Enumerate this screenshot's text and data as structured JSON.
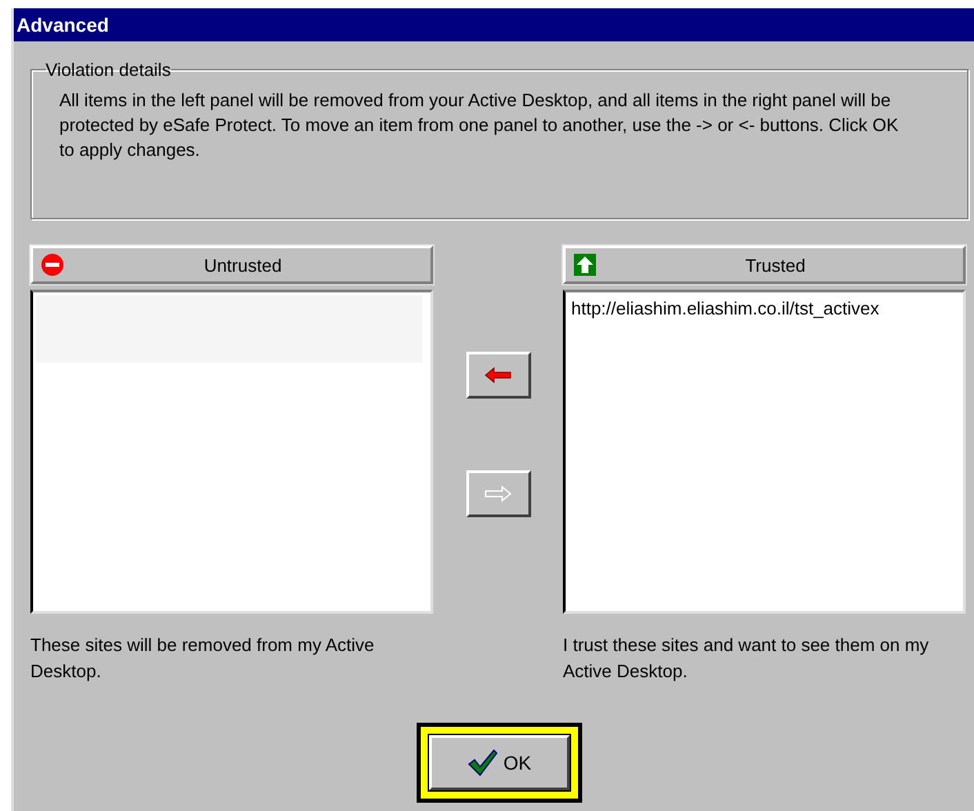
{
  "window": {
    "title": "Advanced"
  },
  "violation_details": {
    "legend": "Violation details",
    "text": "All items in the left panel will be removed from your Active Desktop, and all items in the right panel will be protected by eSafe Protect. To move an item from one panel to another, use the -> or <- buttons. Click OK to apply changes."
  },
  "panels": [
    {
      "kind": "untrusted",
      "header": "Untrusted",
      "caption": "These sites will be removed from my Active Desktop."
    },
    {
      "kind": "trusted",
      "header": "Trusted",
      "items": [
        "http://eliashim.eliashim.co.il/tst_activex"
      ],
      "caption": "I trust these sites and want to see them on my Active Desktop."
    }
  ],
  "move_buttons": [
    {
      "kind": "left",
      "disabled": false
    },
    {
      "kind": "right",
      "disabled": true
    }
  ],
  "ok_button": {
    "label": "OK",
    "highlighted": true
  }
}
